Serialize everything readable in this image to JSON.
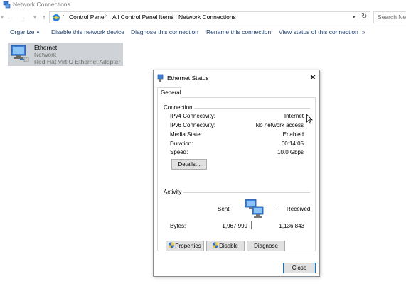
{
  "window": {
    "title": "Network Connections"
  },
  "address": {
    "crumbs": [
      "Control Panel",
      "All Control Panel Items",
      "Network Connections"
    ],
    "search_placeholder": "Search Netw"
  },
  "commands": {
    "organize": "Organize",
    "disable": "Disable this network device",
    "diagnose": "Diagnose this connection",
    "rename": "Rename this connection",
    "view_status": "View status of this connection",
    "more": "»"
  },
  "connection_item": {
    "name": "Ethernet",
    "network": "Network",
    "adapter": "Red Hat VirtIO Ethernet Adapter"
  },
  "dialog": {
    "title": "Ethernet Status",
    "close": "✕",
    "tab": "General",
    "connection_group": "Connection",
    "rows": [
      {
        "label": "IPv4 Connectivity:",
        "value": "Internet"
      },
      {
        "label": "IPv6 Connectivity:",
        "value": "No network access"
      },
      {
        "label": "Media State:",
        "value": "Enabled"
      },
      {
        "label": "Duration:",
        "value": "00:14:05"
      },
      {
        "label": "Speed:",
        "value": "10.0 Gbps"
      }
    ],
    "details_button": "Details...",
    "activity_group": "Activity",
    "sent_label": "Sent",
    "received_label": "Received",
    "bytes_label": "Bytes:",
    "bytes_sent": "1,967,999",
    "bytes_received": "1,136,843",
    "properties_button": "Properties",
    "disable_button": "Disable",
    "diagnose_button": "Diagnose",
    "close_button": "Close"
  },
  "colors": {
    "command_text": "#1e3f6e",
    "selected_item_bg": "#cfd2d6",
    "focus_border": "#0078d7"
  }
}
